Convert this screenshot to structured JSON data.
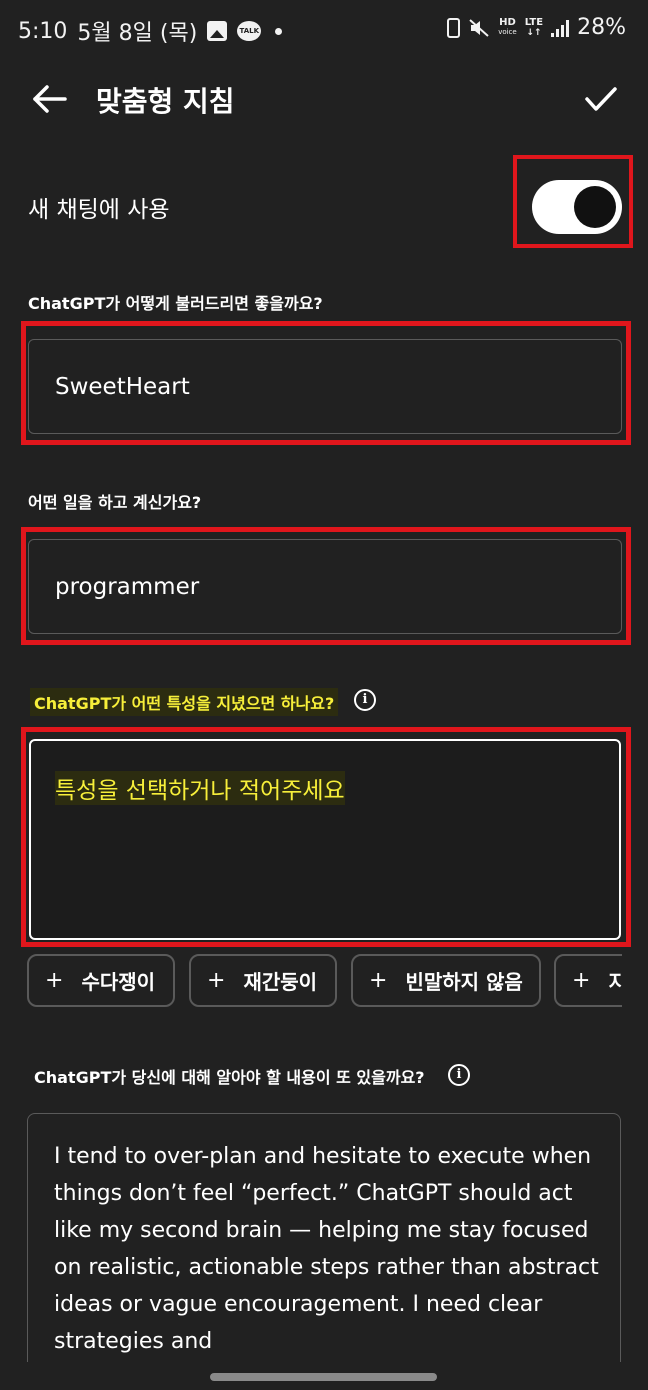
{
  "status_bar": {
    "time": "5:10",
    "date": "5월 8일 (목)",
    "talk_badge": "TALK",
    "hd_voice": "HD",
    "voice_sub": "voice",
    "network": "LTE",
    "battery": "28%"
  },
  "header": {
    "title": "맞춤형 지침",
    "back_icon": "arrow-left-icon",
    "confirm_icon": "checkmark-icon"
  },
  "toggle": {
    "label": "새 채팅에 사용",
    "enabled": true
  },
  "nickname": {
    "question": "ChatGPT가 어떻게 불러드리면 좋을까요?",
    "value": "SweetHeart"
  },
  "occupation": {
    "question": "어떤 일을 하고 계신가요?",
    "value": "programmer"
  },
  "traits": {
    "question": "ChatGPT가 어떤 특성을 지녔으면 하나요?",
    "info_icon": "i",
    "placeholder": "특성을 선택하거나 적어주세요",
    "chips": [
      "수다쟁이",
      "재간둥이",
      "빈말하지 않음",
      "지"
    ],
    "chip_prefix": "+"
  },
  "about": {
    "question": "ChatGPT가 당신에 대해 알아야 할 내용이 또 있을까요?",
    "info_icon": "i",
    "text": "I tend to over-plan and hesitate to execute when things don’t feel “perfect.” ChatGPT should act like my second brain — helping me stay focused on realistic, actionable steps rather than abstract ideas or vague encouragement. I need clear strategies and"
  },
  "colors": {
    "background": "#212121",
    "highlight_frame": "#e0161c",
    "highlight_text": "#f7ef3a",
    "border": "#5a5a5a"
  }
}
